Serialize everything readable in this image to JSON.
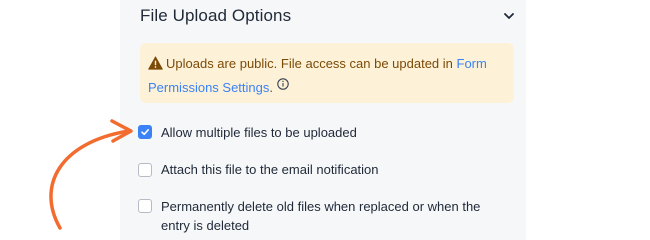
{
  "section": {
    "title": "File Upload Options",
    "chevron_icon": "chevron-down-icon"
  },
  "notice": {
    "icon": "warning-icon",
    "text_before": "Uploads are public. File access can be updated in ",
    "link_text": "Form Permissions Settings",
    "text_after": ".",
    "info_icon": "info-icon"
  },
  "options": [
    {
      "label": "Allow multiple files to be uploaded",
      "checked": true
    },
    {
      "label": "Attach this file to the email notification",
      "checked": false
    },
    {
      "label": "Permanently delete old files when replaced or when the entry is deleted",
      "checked": false
    }
  ],
  "colors": {
    "accent": "#3b82f6",
    "notice_bg": "#fdf2d8",
    "notice_text": "#7c4a07",
    "annotation_arrow": "#f26b2f"
  }
}
